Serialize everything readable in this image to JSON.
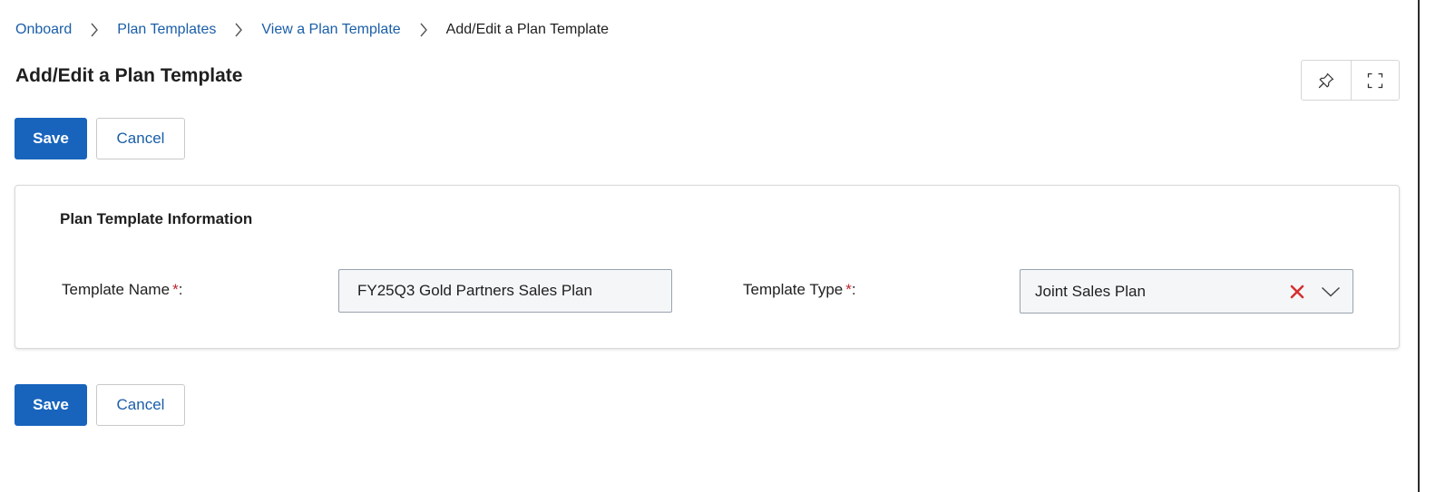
{
  "breadcrumb": {
    "items": [
      "Onboard",
      "Plan Templates",
      "View a Plan Template"
    ],
    "current": "Add/Edit a Plan Template",
    "separator_icon": "chevron-right-icon"
  },
  "page": {
    "title": "Add/Edit a Plan Template",
    "tools": [
      "pin-icon",
      "expand-icon"
    ]
  },
  "actions": {
    "save_label": "Save",
    "cancel_label": "Cancel"
  },
  "panel": {
    "title": "Plan Template Information",
    "required_mark": "*",
    "template_name": {
      "label": "Template Name",
      "suffix": ":",
      "value": "FY25Q3 Gold Partners Sales Plan"
    },
    "template_type": {
      "label": "Template Type",
      "suffix": ":",
      "value": "Joint Sales Plan"
    }
  },
  "colors": {
    "primary": "#1864bd",
    "link": "#1a5ea8",
    "required": "#c0262d",
    "clear_icon": "#d62f2f"
  }
}
